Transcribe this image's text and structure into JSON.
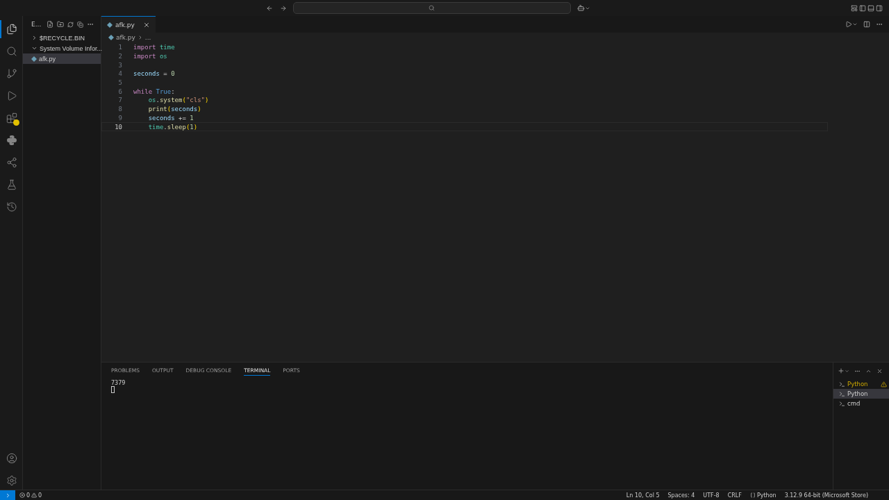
{
  "activity_bar": [
    {
      "kind": "files",
      "selected": true
    },
    {
      "kind": "search",
      "selected": false
    },
    {
      "kind": "source-control",
      "selected": false
    },
    {
      "kind": "run",
      "selected": false
    },
    {
      "kind": "extensions",
      "selected": false,
      "warning": true
    },
    {
      "kind": "python",
      "selected": false
    },
    {
      "kind": "remote",
      "selected": false
    },
    {
      "kind": "testing",
      "selected": false
    },
    {
      "kind": "timeline",
      "selected": false
    }
  ],
  "sidebar": {
    "title": "E...",
    "items": [
      {
        "kind": "folder",
        "label": "$RECYCLE.BIN",
        "expanded": false,
        "selected": false
      },
      {
        "kind": "folder",
        "label": "System Volume Infor...",
        "expanded": true,
        "selected": false
      },
      {
        "kind": "file",
        "label": "afk.py",
        "selected": true
      }
    ]
  },
  "editor": {
    "tabs": [
      {
        "label": "afk.py",
        "selected": true
      }
    ],
    "breadcrumb": [
      "afk.py",
      "..."
    ],
    "lines": [
      {
        "number": "1",
        "current": false,
        "tokens": [
          {
            "kind": "keyword",
            "text": "import "
          },
          {
            "kind": "module",
            "text": "time"
          }
        ]
      },
      {
        "number": "2",
        "current": false,
        "tokens": [
          {
            "kind": "keyword",
            "text": "import "
          },
          {
            "kind": "module",
            "text": "os"
          }
        ]
      },
      {
        "number": "3",
        "current": false
      },
      {
        "number": "4",
        "current": false,
        "tokens": [
          {
            "kind": "variable",
            "text": "seconds"
          },
          {
            "kind": "plain",
            "text": " = "
          },
          {
            "kind": "number",
            "text": "0"
          }
        ]
      },
      {
        "number": "5",
        "current": false
      },
      {
        "number": "6",
        "current": false,
        "tokens": [
          {
            "kind": "keyword",
            "text": "while "
          },
          {
            "kind": "constant",
            "text": "True"
          },
          {
            "kind": "plain",
            "text": ":"
          }
        ]
      },
      {
        "number": "7",
        "current": false,
        "tokens": [
          {
            "kind": "module",
            "text": "    os"
          },
          {
            "kind": "plain",
            "text": "."
          },
          {
            "kind": "function",
            "text": "system"
          },
          {
            "kind": "bracket",
            "text": "("
          },
          {
            "kind": "string",
            "text": "\"cls\""
          },
          {
            "kind": "bracket",
            "text": ")"
          }
        ]
      },
      {
        "number": "8",
        "current": false,
        "tokens": [
          {
            "kind": "function",
            "text": "    print"
          },
          {
            "kind": "bracket",
            "text": "("
          },
          {
            "kind": "variable",
            "text": "seconds"
          },
          {
            "kind": "bracket",
            "text": ")"
          }
        ]
      },
      {
        "number": "9",
        "current": false,
        "tokens": [
          {
            "kind": "variable",
            "text": "    seconds"
          },
          {
            "kind": "plain",
            "text": " += "
          },
          {
            "kind": "number",
            "text": "1"
          }
        ]
      },
      {
        "number": "10",
        "current": true,
        "tokens": [
          {
            "kind": "module",
            "text": "    time"
          },
          {
            "kind": "plain",
            "text": "."
          },
          {
            "kind": "function",
            "text": "sleep"
          },
          {
            "kind": "bracket",
            "text": "("
          },
          {
            "kind": "number",
            "text": "1"
          },
          {
            "kind": "bracket",
            "text": ")"
          }
        ]
      }
    ]
  },
  "panel": {
    "tabs": [
      {
        "label": "PROBLEMS",
        "selected": false
      },
      {
        "label": "OUTPUT",
        "selected": false
      },
      {
        "label": "DEBUG CONSOLE",
        "selected": false
      },
      {
        "label": "TERMINAL",
        "selected": true
      },
      {
        "label": "PORTS",
        "selected": false
      }
    ],
    "terminal_output": "7379",
    "terminals": [
      {
        "label": "Python",
        "selected": false,
        "warning": true
      },
      {
        "label": "Python",
        "selected": true,
        "warning": false
      },
      {
        "label": "cmd",
        "selected": false,
        "warning": false
      }
    ]
  },
  "status_bar": {
    "errors": "0",
    "warnings": "0",
    "items": [
      "Ln 10, Col 5",
      "Spaces: 4",
      "UTF-8",
      "CRLF"
    ],
    "language": "Python",
    "interpreter": "3.12.9 64-bit (Microsoft Store)"
  }
}
